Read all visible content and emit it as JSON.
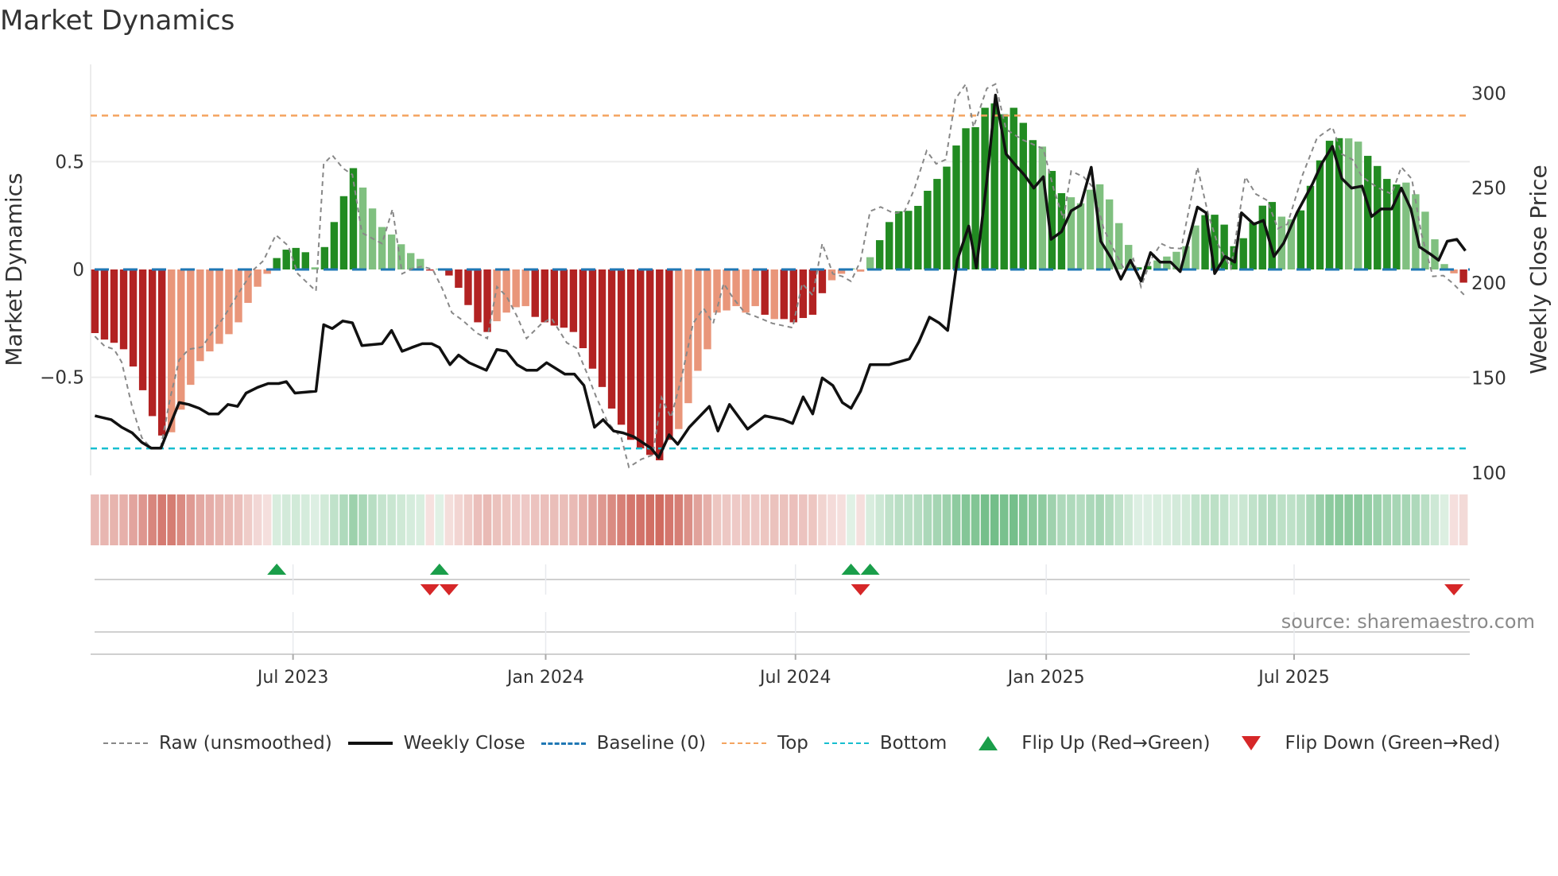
{
  "title": "Market Dynamics",
  "source": "source: sharemaestro.com",
  "colors": {
    "dark_red": "#b22222",
    "light_red": "#e9967a",
    "dark_green": "#228b22",
    "light_green": "#80c080",
    "baseline": "#1f77b4",
    "top": "#f4a460",
    "bottom": "#17becf",
    "close": "#111111",
    "raw": "#888888",
    "flip_up": "#1a9e4a",
    "flip_down": "#d62728",
    "strip_red": "#c0392b",
    "strip_green": "#2e9e4f"
  },
  "legend": [
    {
      "key": "raw",
      "label": "Raw (unsmoothed)"
    },
    {
      "key": "close",
      "label": "Weekly Close"
    },
    {
      "key": "baseline",
      "label": "Baseline (0)"
    },
    {
      "key": "top",
      "label": "Top"
    },
    {
      "key": "bottom",
      "label": "Bottom"
    },
    {
      "key": "flip_up",
      "label": "Flip Up (Red→Green)"
    },
    {
      "key": "flip_down",
      "label": "Flip Down (Green→Red)"
    }
  ],
  "chart_data": {
    "type": "bar",
    "title": "Market Dynamics",
    "ylabel": "Market Dynamics",
    "ylabel_right": "Weekly Close Price",
    "ylim": [
      -0.98,
      0.98
    ],
    "ylim_right": [
      100,
      310
    ],
    "yticks": [
      {
        "v": 0.5,
        "label": "0.5"
      },
      {
        "v": 0,
        "label": "0"
      },
      {
        "v": -0.5,
        "label": "−0.5"
      }
    ],
    "yticks_right": [
      300,
      250,
      200,
      150,
      100
    ],
    "xticks": [
      {
        "week": 21.7,
        "label": "Jul 2023"
      },
      {
        "week": 48.1,
        "label": "Jan 2024"
      },
      {
        "week": 74.2,
        "label": "Jul 2024"
      },
      {
        "week": 100.4,
        "label": "Jan 2025"
      },
      {
        "week": 126.3,
        "label": "Jul 2025"
      }
    ],
    "top_level": 0.714,
    "bottom_level": -0.83,
    "momentum": [
      -0.295,
      -0.325,
      -0.34,
      -0.37,
      -0.45,
      -0.56,
      -0.68,
      -0.77,
      -0.755,
      -0.65,
      -0.535,
      -0.425,
      -0.38,
      -0.345,
      -0.3,
      -0.245,
      -0.155,
      -0.08,
      -0.02,
      0.053,
      0.092,
      0.1,
      0.08,
      0.01,
      0.104,
      0.22,
      0.34,
      0.47,
      0.38,
      0.283,
      0.197,
      0.162,
      0.117,
      0.076,
      0.049,
      -0.005,
      0.003,
      -0.028,
      -0.085,
      -0.165,
      -0.245,
      -0.29,
      -0.24,
      -0.2,
      -0.175,
      -0.17,
      -0.22,
      -0.245,
      -0.26,
      -0.27,
      -0.29,
      -0.365,
      -0.46,
      -0.545,
      -0.645,
      -0.72,
      -0.79,
      -0.83,
      -0.86,
      -0.885,
      -0.79,
      -0.74,
      -0.62,
      -0.47,
      -0.37,
      -0.2,
      -0.19,
      -0.17,
      -0.2,
      -0.17,
      -0.21,
      -0.23,
      -0.23,
      -0.245,
      -0.225,
      -0.21,
      -0.11,
      -0.05,
      -0.02,
      0.005,
      -0.01,
      0.057,
      0.136,
      0.22,
      0.27,
      0.272,
      0.295,
      0.365,
      0.42,
      0.477,
      0.575,
      0.655,
      0.66,
      0.75,
      0.77,
      0.72,
      0.75,
      0.68,
      0.6,
      0.57,
      0.457,
      0.354,
      0.335,
      0.307,
      0.37,
      0.395,
      0.325,
      0.215,
      0.114,
      0.01,
      0.016,
      0.042,
      0.06,
      0.082,
      0.108,
      0.204,
      0.252,
      0.254,
      0.208,
      0.108,
      0.145,
      0.219,
      0.296,
      0.313,
      0.245,
      0.233,
      0.274,
      0.388,
      0.506,
      0.597,
      0.609,
      0.608,
      0.593,
      0.527,
      0.48,
      0.42,
      0.394,
      0.403,
      0.349,
      0.268,
      0.14,
      0.025,
      -0.018,
      -0.061
    ],
    "shade": "ddddddddlllllllllllddddlddddllllllldldddddlllldddddddddddddddllllllllldldddddllllldddddddddddddddddlddlllllllddlllllddddddddlldddddllddddlllllldlllldd",
    "weekly_close": [
      [
        1,
        130
      ],
      [
        2.7,
        128
      ],
      [
        3.8,
        124
      ],
      [
        4.9,
        121
      ],
      [
        5.9,
        116
      ],
      [
        6.9,
        113
      ],
      [
        7.9,
        113
      ],
      [
        9,
        127
      ],
      [
        9.8,
        137
      ],
      [
        10.8,
        136
      ],
      [
        11.9,
        134
      ],
      [
        12.9,
        131
      ],
      [
        13.9,
        131
      ],
      [
        14.9,
        136
      ],
      [
        15.9,
        135
      ],
      [
        16.8,
        142
      ],
      [
        18,
        145
      ],
      [
        19.1,
        147
      ],
      [
        20.2,
        147
      ],
      [
        21,
        148
      ],
      [
        21.9,
        142
      ],
      [
        24.1,
        143
      ],
      [
        24.9,
        178
      ],
      [
        25.8,
        176
      ],
      [
        26.9,
        180
      ],
      [
        27.9,
        179
      ],
      [
        28.9,
        167
      ],
      [
        31,
        168
      ],
      [
        32,
        175
      ],
      [
        33.1,
        164
      ],
      [
        34.1,
        166
      ],
      [
        35.2,
        168
      ],
      [
        36.2,
        168
      ],
      [
        37,
        166
      ],
      [
        38.1,
        157
      ],
      [
        39,
        162
      ],
      [
        40.1,
        158
      ],
      [
        41.9,
        154
      ],
      [
        43,
        165
      ],
      [
        44,
        164
      ],
      [
        45.1,
        157
      ],
      [
        46.1,
        154
      ],
      [
        47.2,
        154
      ],
      [
        48.2,
        158
      ],
      [
        50.1,
        152
      ],
      [
        51.1,
        152
      ],
      [
        52.1,
        146
      ],
      [
        53.2,
        124
      ],
      [
        54.1,
        128
      ],
      [
        55.2,
        122
      ],
      [
        56.2,
        121
      ],
      [
        57.3,
        119
      ],
      [
        59.1,
        113
      ],
      [
        59.9,
        108
      ],
      [
        61,
        120
      ],
      [
        61.9,
        115
      ],
      [
        63.1,
        124
      ],
      [
        65.2,
        135
      ],
      [
        66.1,
        122
      ],
      [
        67.3,
        136
      ],
      [
        69.2,
        123
      ],
      [
        71,
        130
      ],
      [
        72.9,
        128
      ],
      [
        73.9,
        126
      ],
      [
        75,
        140
      ],
      [
        76,
        131
      ],
      [
        77,
        150
      ],
      [
        78.1,
        146
      ],
      [
        79.1,
        137
      ],
      [
        80,
        134
      ],
      [
        81,
        143
      ],
      [
        82,
        157
      ],
      [
        83.1,
        157
      ],
      [
        84,
        157
      ],
      [
        86.1,
        160
      ],
      [
        87.1,
        169
      ],
      [
        88.2,
        182
      ],
      [
        89.2,
        179
      ],
      [
        90.1,
        175
      ],
      [
        91.1,
        212
      ],
      [
        92.3,
        230
      ],
      [
        93.1,
        208
      ],
      [
        94.2,
        254
      ],
      [
        95.1,
        299
      ],
      [
        96.2,
        268
      ],
      [
        97.2,
        262
      ],
      [
        98.1,
        257
      ],
      [
        99.1,
        250
      ],
      [
        100.1,
        256
      ],
      [
        100.9,
        223
      ],
      [
        102,
        227
      ],
      [
        103,
        238
      ],
      [
        104,
        241
      ],
      [
        105.1,
        261
      ],
      [
        106.1,
        222
      ],
      [
        107.2,
        213
      ],
      [
        108.2,
        202
      ],
      [
        109.2,
        212
      ],
      [
        110.3,
        201
      ],
      [
        111.3,
        216
      ],
      [
        112.3,
        211
      ],
      [
        113.4,
        211
      ],
      [
        114.4,
        206
      ],
      [
        116.2,
        240
      ],
      [
        117.1,
        237
      ],
      [
        118,
        205
      ],
      [
        119.1,
        214
      ],
      [
        120.1,
        211
      ],
      [
        120.8,
        237
      ],
      [
        122.1,
        231
      ],
      [
        123.1,
        233
      ],
      [
        124.2,
        214
      ],
      [
        125.2,
        221
      ],
      [
        126.6,
        237
      ],
      [
        128.2,
        252
      ],
      [
        129.2,
        263
      ],
      [
        130.3,
        272
      ],
      [
        131.3,
        255
      ],
      [
        132.3,
        250
      ],
      [
        133.4,
        251
      ],
      [
        134.4,
        235
      ],
      [
        135.4,
        239
      ],
      [
        136.5,
        239
      ],
      [
        137.5,
        250
      ],
      [
        138.5,
        239
      ],
      [
        139.4,
        219
      ],
      [
        140.6,
        215
      ],
      [
        141.4,
        212
      ],
      [
        142.3,
        222
      ],
      [
        143.3,
        223
      ],
      [
        144.2,
        217
      ]
    ],
    "raw": [
      [
        1,
        -0.31
      ],
      [
        2,
        -0.355
      ],
      [
        3,
        -0.37
      ],
      [
        3.8,
        -0.43
      ],
      [
        4.9,
        -0.64
      ],
      [
        5.9,
        -0.78
      ],
      [
        6.9,
        -0.83
      ],
      [
        7.9,
        -0.82
      ],
      [
        8.9,
        -0.59
      ],
      [
        9.8,
        -0.42
      ],
      [
        10.8,
        -0.37
      ],
      [
        12.2,
        -0.36
      ],
      [
        13.2,
        -0.295
      ],
      [
        14.4,
        -0.226
      ],
      [
        16,
        -0.11
      ],
      [
        17.6,
        0
      ],
      [
        18.6,
        0.04
      ],
      [
        19.9,
        0.16
      ],
      [
        21.2,
        0.11
      ],
      [
        22.2,
        -0.02
      ],
      [
        24.1,
        -0.1
      ],
      [
        24.9,
        0.49
      ],
      [
        25.8,
        0.53
      ],
      [
        26.9,
        0.47
      ],
      [
        27.9,
        0.44
      ],
      [
        28.9,
        0.17
      ],
      [
        31,
        0.12
      ],
      [
        32.1,
        0.28
      ],
      [
        33.1,
        -0.02
      ],
      [
        34.2,
        0.005
      ],
      [
        35.2,
        0.014
      ],
      [
        36.3,
        0
      ],
      [
        37.3,
        -0.09
      ],
      [
        38.3,
        -0.2
      ],
      [
        39.4,
        -0.235
      ],
      [
        40.9,
        -0.295
      ],
      [
        42,
        -0.32
      ],
      [
        43,
        -0.08
      ],
      [
        44,
        -0.124
      ],
      [
        45.1,
        -0.217
      ],
      [
        46.1,
        -0.32
      ],
      [
        47.7,
        -0.25
      ],
      [
        48.7,
        -0.226
      ],
      [
        50.3,
        -0.34
      ],
      [
        51.3,
        -0.364
      ],
      [
        52.4,
        -0.48
      ],
      [
        53.4,
        -0.594
      ],
      [
        54.6,
        -0.71
      ],
      [
        56,
        -0.78
      ],
      [
        56.8,
        -0.917
      ],
      [
        58.1,
        -0.88
      ],
      [
        59.3,
        -0.86
      ],
      [
        60.2,
        -0.594
      ],
      [
        61.2,
        -0.687
      ],
      [
        62.3,
        -0.5
      ],
      [
        63.5,
        -0.25
      ],
      [
        64.6,
        -0.18
      ],
      [
        65.6,
        -0.25
      ],
      [
        66.7,
        -0.065
      ],
      [
        67.7,
        -0.134
      ],
      [
        68.9,
        -0.2
      ],
      [
        70,
        -0.217
      ],
      [
        71.8,
        -0.25
      ],
      [
        73.9,
        -0.27
      ],
      [
        74.9,
        -0.065
      ],
      [
        76,
        -0.12
      ],
      [
        77,
        0.12
      ],
      [
        78.1,
        -0.02
      ],
      [
        79.1,
        -0.032
      ],
      [
        80,
        -0.055
      ],
      [
        81,
        0.04
      ],
      [
        82,
        0.27
      ],
      [
        83.1,
        0.29
      ],
      [
        84.5,
        0.26
      ],
      [
        85.6,
        0.27
      ],
      [
        86.6,
        0.37
      ],
      [
        87.9,
        0.55
      ],
      [
        88.9,
        0.49
      ],
      [
        89.9,
        0.51
      ],
      [
        90.9,
        0.79
      ],
      [
        92,
        0.86
      ],
      [
        92.8,
        0.66
      ],
      [
        94.2,
        0.84
      ],
      [
        95.1,
        0.86
      ],
      [
        96.2,
        0.65
      ],
      [
        98,
        0.6
      ],
      [
        100.1,
        0.56
      ],
      [
        101.2,
        0.37
      ],
      [
        102.2,
        0.235
      ],
      [
        103,
        0.456
      ],
      [
        104.3,
        0.43
      ],
      [
        105.3,
        0.38
      ],
      [
        106.4,
        0.19
      ],
      [
        107.4,
        0.097
      ],
      [
        108.5,
        0.005
      ],
      [
        109.5,
        0.05
      ],
      [
        110.3,
        -0.08
      ],
      [
        111.4,
        0.05
      ],
      [
        112.4,
        0.12
      ],
      [
        113.4,
        0.1
      ],
      [
        114.5,
        0.097
      ],
      [
        116.2,
        0.475
      ],
      [
        117.3,
        0.26
      ],
      [
        118.3,
        0.12
      ],
      [
        119.7,
        0.005
      ],
      [
        121.2,
        0.43
      ],
      [
        122.3,
        0.35
      ],
      [
        123.5,
        0.32
      ],
      [
        124.6,
        0.19
      ],
      [
        125.6,
        0.21
      ],
      [
        127.2,
        0.44
      ],
      [
        128.7,
        0.61
      ],
      [
        130.3,
        0.66
      ],
      [
        131.3,
        0.535
      ],
      [
        132.4,
        0.51
      ],
      [
        133.4,
        0.43
      ],
      [
        135,
        0.38
      ],
      [
        136.5,
        0.35
      ],
      [
        137.5,
        0.475
      ],
      [
        138.6,
        0.42
      ],
      [
        139.6,
        0.166
      ],
      [
        140.8,
        -0.032
      ],
      [
        141.9,
        -0.028
      ],
      [
        142.9,
        -0.065
      ],
      [
        144.2,
        -0.124
      ]
    ],
    "flip_up_weeks": [
      20,
      37,
      80,
      82
    ],
    "flip_down_weeks": [
      36,
      38,
      81,
      143
    ],
    "grid": true,
    "legend_position": "bottom"
  }
}
